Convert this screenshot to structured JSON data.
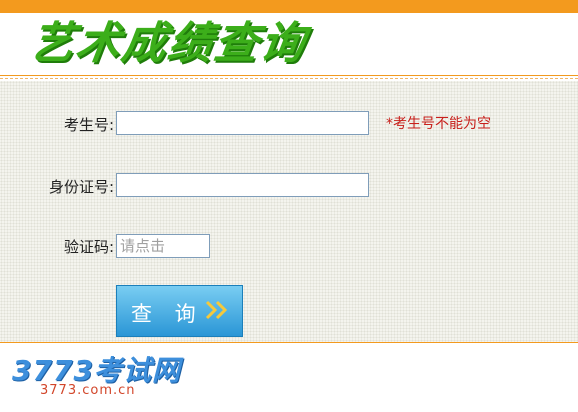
{
  "header": {
    "title": "艺术成绩查询"
  },
  "form": {
    "exam_number": {
      "label": "考生号:",
      "value": "",
      "error": "*考生号不能为空"
    },
    "id_number": {
      "label": "身份证号:",
      "value": ""
    },
    "captcha": {
      "label": "验证码:",
      "placeholder": "请点击",
      "value": ""
    },
    "submit": {
      "label": "查 询",
      "chevron": "»"
    }
  },
  "footer": {
    "logo_text": "3773考试网",
    "logo_url": "3773.com.cn"
  },
  "colors": {
    "accent": "#f39a1e",
    "title_green": "#3cae1a",
    "button_blue": "#2a96d6",
    "error_red": "#c8201c"
  }
}
